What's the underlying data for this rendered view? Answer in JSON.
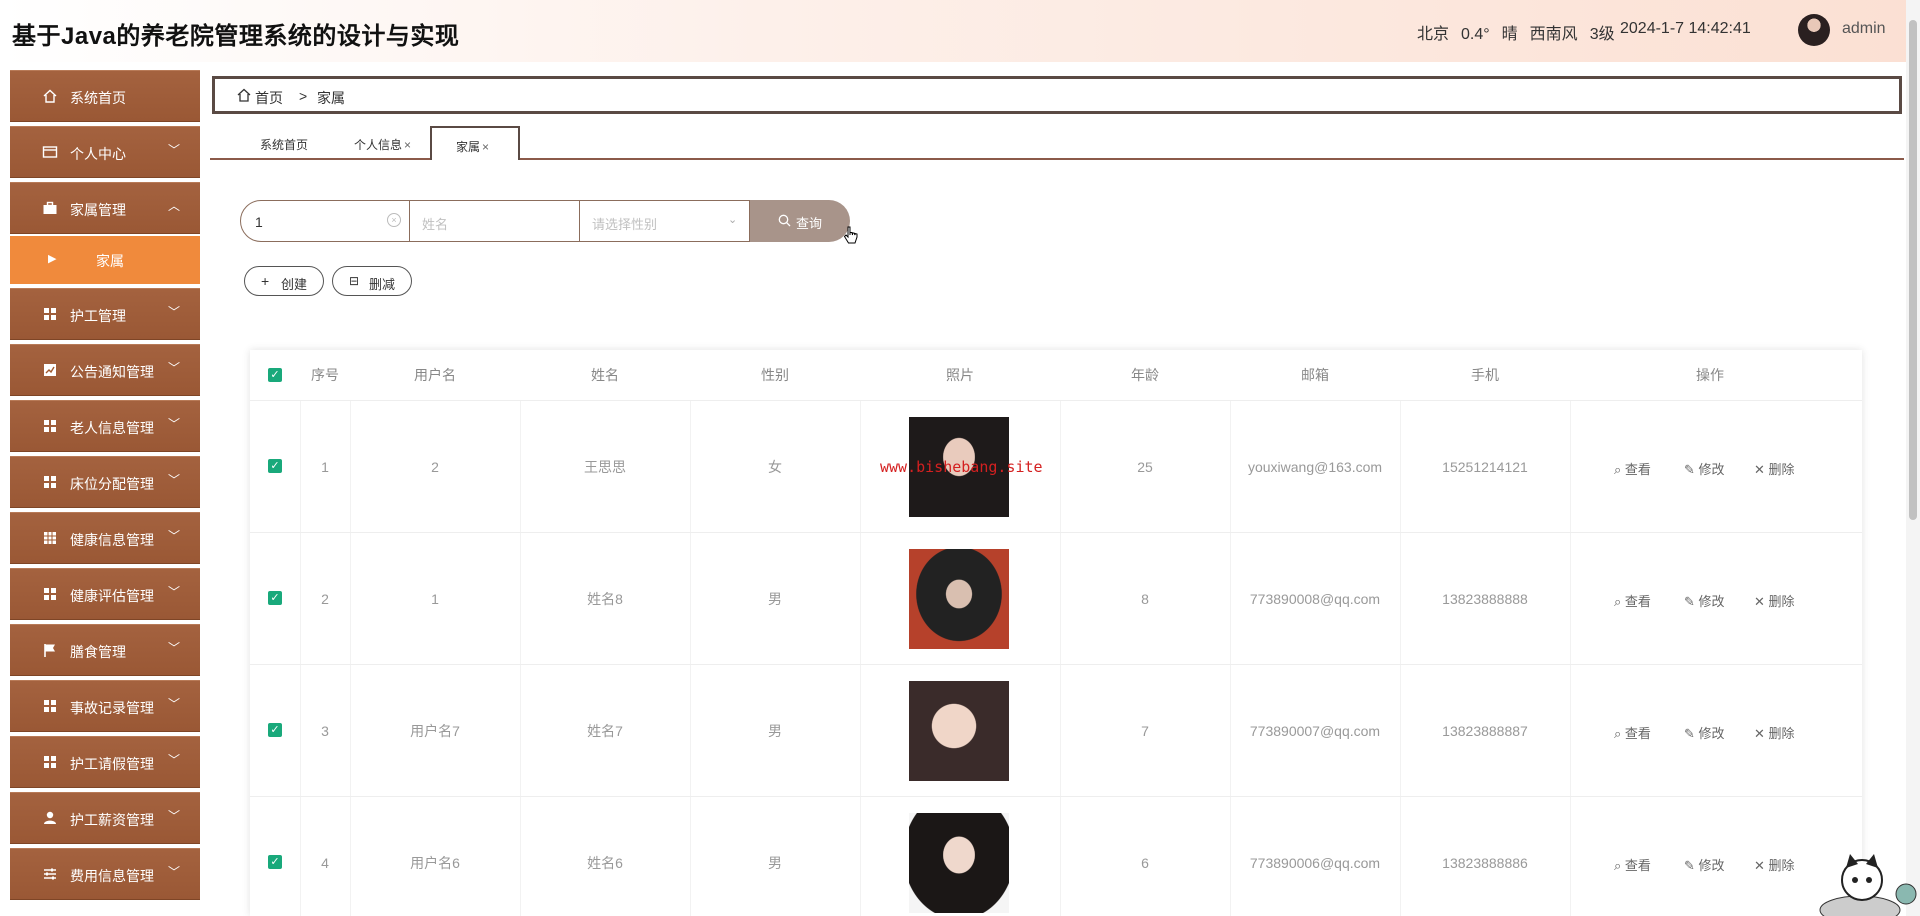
{
  "header": {
    "title": "基于Java的养老院管理系统的设计与实现",
    "weather": {
      "city": "北京",
      "temp": "0.4°",
      "condition": "晴",
      "wind": "西南风",
      "level": "3级"
    },
    "datetime": "2024-1-7 14:42:41",
    "username": "admin"
  },
  "sidebar": {
    "items": [
      {
        "label": "系统首页",
        "icon": "home-icon"
      },
      {
        "label": "个人中心",
        "icon": "card-icon"
      },
      {
        "label": "家属管理",
        "icon": "briefcase-icon",
        "expanded": true
      },
      {
        "label": "护工管理",
        "icon": "grid-icon"
      },
      {
        "label": "公告通知管理",
        "icon": "chart-icon"
      },
      {
        "label": "老人信息管理",
        "icon": "grid-icon"
      },
      {
        "label": "床位分配管理",
        "icon": "grid-icon"
      },
      {
        "label": "健康信息管理",
        "icon": "table-icon"
      },
      {
        "label": "健康评估管理",
        "icon": "grid-icon"
      },
      {
        "label": "膳食管理",
        "icon": "flag-icon"
      },
      {
        "label": "事故记录管理",
        "icon": "grid-icon"
      },
      {
        "label": "护工请假管理",
        "icon": "grid-icon"
      },
      {
        "label": "护工薪资管理",
        "icon": "user-icon"
      },
      {
        "label": "费用信息管理",
        "icon": "sliders-icon"
      }
    ],
    "sub_item": "家属",
    "accent": "#f08a3c",
    "menu_bg": "#a0592f"
  },
  "breadcrumb": {
    "home": "首页",
    "sep": ">",
    "current": "家属"
  },
  "tabs": [
    {
      "label": "系统首页",
      "closable": false
    },
    {
      "label": "个人信息",
      "closable": true
    },
    {
      "label": "家属",
      "closable": true,
      "active": true
    }
  ],
  "tab_close": "×",
  "search": {
    "username_value": "1",
    "name_placeholder": "姓名",
    "gender_placeholder": "请选择性别",
    "button": "查询"
  },
  "actions": {
    "create": "创建",
    "delete": "删减"
  },
  "table": {
    "headers": [
      "序号",
      "用户名",
      "姓名",
      "性别",
      "照片",
      "年龄",
      "邮箱",
      "手机",
      "操作"
    ],
    "rows": [
      {
        "no": "1",
        "username": "2",
        "name": "王思思",
        "gender": "女",
        "age": "25",
        "email": "youxiwang@163.com",
        "phone": "15251214121"
      },
      {
        "no": "2",
        "username": "1",
        "name": "姓名8",
        "gender": "男",
        "age": "8",
        "email": "773890008@qq.com",
        "phone": "13823888888"
      },
      {
        "no": "3",
        "username": "用户名7",
        "name": "姓名7",
        "gender": "男",
        "age": "7",
        "email": "773890007@qq.com",
        "phone": "13823888887"
      },
      {
        "no": "4",
        "username": "用户名6",
        "name": "姓名6",
        "gender": "男",
        "age": "6",
        "email": "773890006@qq.com",
        "phone": "13823888886"
      }
    ],
    "ops": {
      "view": "查看",
      "edit": "修改",
      "delete": "删除"
    }
  },
  "watermark": "www.bishebang.site"
}
